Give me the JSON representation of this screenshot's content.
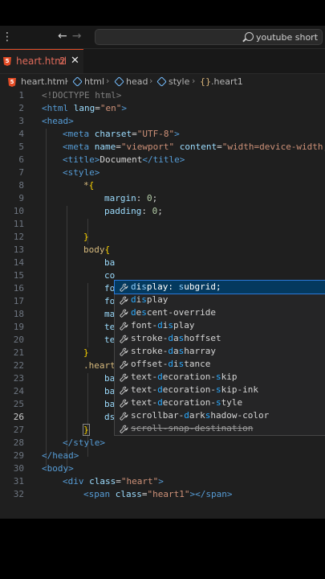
{
  "titlebar": {
    "menu_glyph": "⋮",
    "back_glyph": "←",
    "forward_glyph": "→",
    "search_text": "youtube short"
  },
  "tab": {
    "filename": "heart.html",
    "problem_count": "2",
    "close_glyph": "✕"
  },
  "breadcrumb": [
    "heart.html",
    "html",
    "head",
    "style",
    ".heart1"
  ],
  "gutter": [
    "1",
    "2",
    "3",
    "4",
    "5",
    "6",
    "7",
    "8",
    "9",
    "10",
    "11",
    "12",
    "13",
    "14",
    "15",
    "16",
    "17",
    "18",
    "19",
    "20",
    "21",
    "22",
    "23",
    "24",
    "25",
    "26",
    "27",
    "28",
    "29",
    "30",
    "31",
    "32"
  ],
  "code": {
    "l1_a": "<!DOC",
    "l1_b": "TYPE html",
    "l1_c": ">",
    "l2_a": "<html ",
    "l2_b": "lang",
    "l2_c": "=",
    "l2_d": "\"en\"",
    "l2_e": ">",
    "l3": "<head>",
    "l4_a": "<meta ",
    "l4_b": "charset",
    "l4_c": "=",
    "l4_d": "\"UTF-8\"",
    "l4_e": ">",
    "l5_a": "<meta ",
    "l5_b": "name",
    "l5_c": "=",
    "l5_d": "\"viewport\"",
    "l5_e": " content",
    "l5_f": "=",
    "l5_g": "\"width=device-width,",
    "l6_a": "<title>",
    "l6_b": "Document",
    "l6_c": "</title>",
    "l7": "<style>",
    "l8_a": "*",
    "l8_b": "{",
    "l9_a": "margin",
    "l9_b": ": ",
    "l9_c": "0",
    "l9_d": ";",
    "l10_a": "padding",
    "l10_b": ": ",
    "l10_c": "0",
    "l10_d": ";",
    "l12": "}",
    "l13_a": "body",
    "l13_b": "{",
    "l14": "ba",
    "l15": "co",
    "l16": "fo",
    "l17": "fo",
    "l18": "ma",
    "l19": "te",
    "l20": "te",
    "l21": "}",
    "l22": ".heart",
    "l23": "ba",
    "l24": "ba",
    "l25": "ba",
    "l26": "ds",
    "l27": "}",
    "l28": "</style>",
    "l29": "</head>",
    "l30": "<body>",
    "l31_a": "<div ",
    "l31_b": "class",
    "l31_c": "=",
    "l31_d": "\"heart\"",
    "l31_e": ">",
    "l32_a": "<span ",
    "l32_b": "class",
    "l32_c": "=",
    "l32_d": "\"heart1\"",
    "l32_e": "></span>"
  },
  "suggestions": [
    {
      "parts": [
        "",
        "d",
        "i",
        "s",
        "play: ",
        "s",
        "ubgrid;"
      ]
    },
    {
      "parts": [
        "",
        "d",
        "i",
        "s",
        "play",
        "",
        ""
      ]
    },
    {
      "parts": [
        "",
        "d",
        "e",
        "s",
        "cent-override",
        "",
        ""
      ]
    },
    {
      "parts": [
        "font-",
        "d",
        "i",
        "s",
        "play",
        "",
        ""
      ]
    },
    {
      "parts": [
        "stroke-",
        "d",
        "a",
        "s",
        "hoffset",
        "",
        ""
      ]
    },
    {
      "parts": [
        "stroke-",
        "d",
        "a",
        "s",
        "harray",
        "",
        ""
      ]
    },
    {
      "parts": [
        "offset-",
        "d",
        "i",
        "s",
        "tance",
        "",
        ""
      ]
    },
    {
      "parts": [
        "text-",
        "d",
        "e",
        "",
        "coration-",
        "s",
        "kip"
      ]
    },
    {
      "parts": [
        "text-",
        "d",
        "e",
        "",
        "coration-",
        "s",
        "kip-ink"
      ]
    },
    {
      "parts": [
        "text-",
        "d",
        "e",
        "",
        "coration-",
        "s",
        "tyle"
      ]
    },
    {
      "parts": [
        "scrollbar-",
        "d",
        "a",
        "",
        "rk",
        "s",
        "hadow-color"
      ]
    },
    {
      "parts": [
        "",
        "",
        "",
        "",
        "scroll-snap-destination",
        "",
        ""
      ]
    }
  ],
  "colors": {
    "background": "#1f1f1f",
    "keyword": "#569cd6",
    "attribute": "#9cdcfe",
    "string": "#ce9178",
    "selection": "#04395e",
    "accent": "#2aaaff"
  }
}
